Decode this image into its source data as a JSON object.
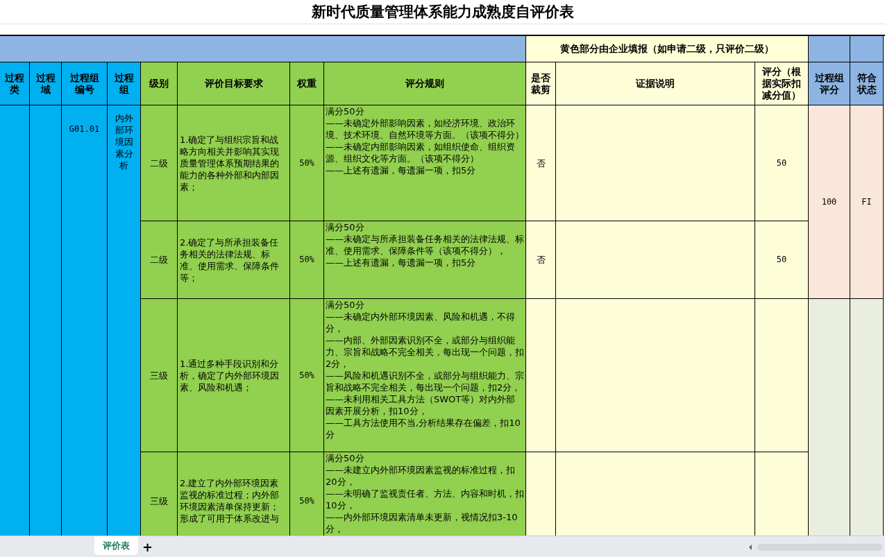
{
  "title": "新时代质量管理体系能力成熟度自评价表",
  "banner": "黄色部分由企业填报（如申请二级，只评价二级）",
  "columns": [
    "过程类",
    "过程域",
    "过程组编号",
    "过程组",
    "级别",
    "评价目标要求",
    "权重",
    "评分规则",
    "是否裁剪",
    "证据说明",
    "评分（根据实际扣减分值）",
    "过程组评分",
    "符合状态"
  ],
  "process_group": {
    "code": "G01.01",
    "name": "内外部环境因素分析"
  },
  "score_groups": [
    {
      "score": "100",
      "status": "FI",
      "rows": [
        {
          "level": "二级",
          "requirement": "1.确定了与组织宗旨和战略方向相关并影响其实现质量管理体系预期结果的能力的各种外部和内部因素；",
          "weight": "50%",
          "rule": "满分50分\n——未确定外部影响因素，如经济环境、政治环境、技术环境、自然环境等方面。（该项不得分）\n——未确定内部影响因素，如组织使命、组织资源、组织文化等方面。（该项不得分）\n——上述有遗漏，每遗漏一项，扣5分",
          "cropped": "否",
          "score": "50"
        },
        {
          "level": "二级",
          "requirement": "2.确定了与所承担装备任务相关的法律法规、标准、使用需求、保障条件等；",
          "weight": "50%",
          "rule": "满分50分\n——未确定与所承担装备任务相关的法律法规、标准、使用需求、保障条件等（该项不得分），\n——上述有遗漏，每遗漏一项，扣5分",
          "cropped": "否",
          "score": "50"
        }
      ]
    },
    {
      "rows": [
        {
          "level": "三级",
          "requirement": "1.通过多种手段识别和分析，确定了内外部环境因素、风险和机遇；",
          "weight": "50%",
          "rule": "满分50分\n——未确定内外部环境因素、风险和机遇，不得分，\n——内部、外部因素识别不全，或部分与组织能力、宗旨和战略不完全相关，每出现一个问题，扣2分，\n——风险和机遇识别不全，或部分与组织能力、宗旨和战略不完全相关，每出现一个问题，扣2分，\n——未利用相关工具方法（SWOT等）对内外部因素开展分析，扣10分，\n——工具方法使用不当,分析结果存在偏差，扣10分"
        },
        {
          "level": "三级",
          "requirement": "2.建立了内外部环境因素监视的标准过程；内外部环境因素清单保持更新；形成了可用于体系改进与",
          "weight": "50%",
          "rule": "满分50分\n——未建立内外部环境因素监视的标准过程，扣20分，\n——未明确了监视责任者、方法、内容和时机，扣10分，\n——内外部环境因素清单未更新，视情况扣3-10分，"
        }
      ]
    }
  ],
  "sheet_tabs": [
    {
      "label": "评价表",
      "selected": true
    }
  ],
  "add_sheet": "+"
}
